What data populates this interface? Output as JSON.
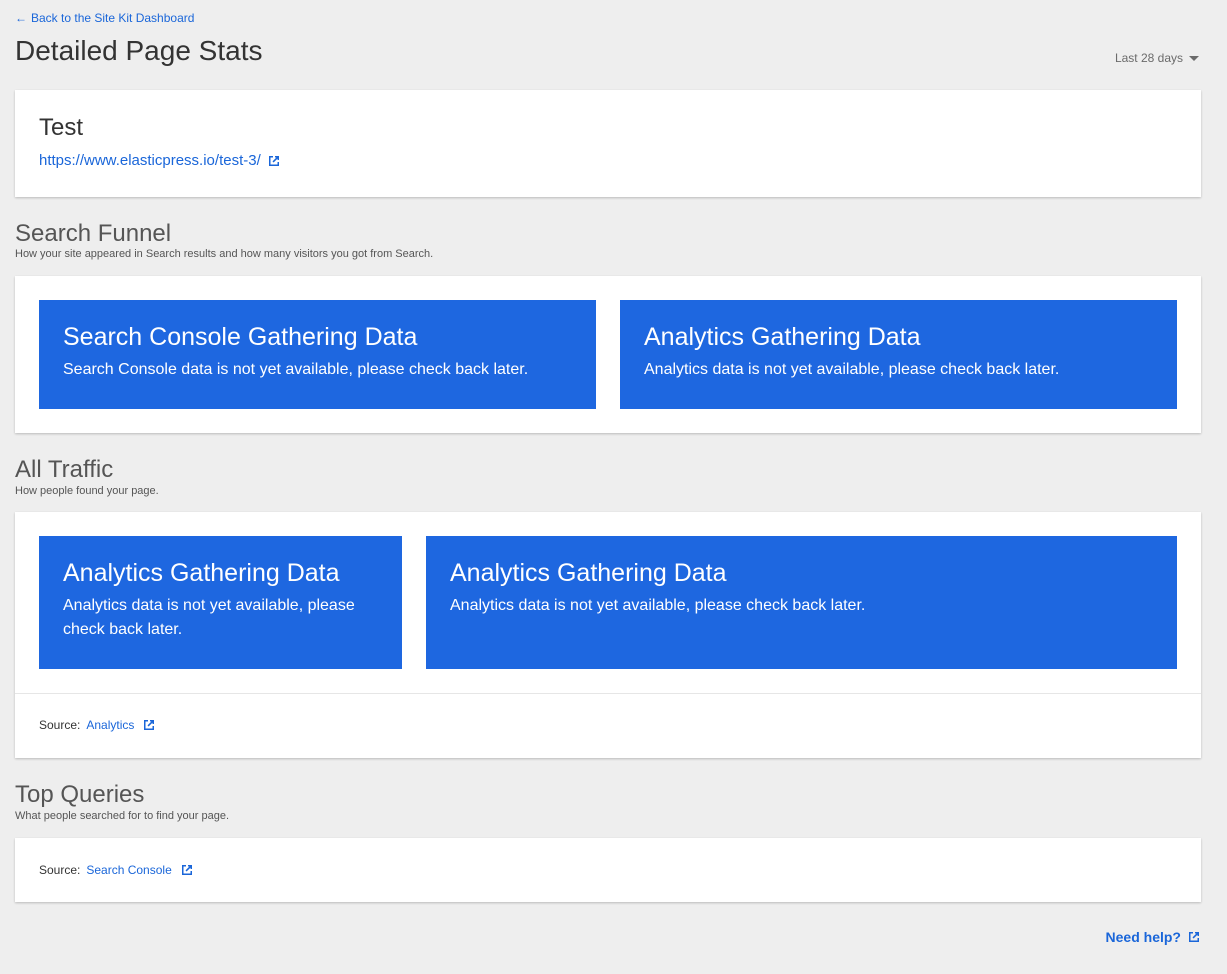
{
  "nav": {
    "back_label": "Back to the Site Kit Dashboard"
  },
  "header": {
    "title": "Detailed Page Stats",
    "date_range": "Last 28 days"
  },
  "page_card": {
    "title": "Test",
    "url": "https://www.elasticpress.io/test-3/"
  },
  "search_funnel": {
    "title": "Search Funnel",
    "description": "How your site appeared in Search results and how many visitors you got from Search.",
    "notices": [
      {
        "title": "Search Console Gathering Data",
        "text": "Search Console data is not yet available, please check back later."
      },
      {
        "title": "Analytics Gathering Data",
        "text": "Analytics data is not yet available, please check back later."
      }
    ]
  },
  "all_traffic": {
    "title": "All Traffic",
    "description": "How people found your page.",
    "notices": [
      {
        "title": "Analytics Gathering Data",
        "text": "Analytics data is not yet available, please check back later."
      },
      {
        "title": "Analytics Gathering Data",
        "text": "Analytics data is not yet available, please check back later."
      }
    ],
    "source_label": "Source:",
    "source_link": "Analytics"
  },
  "top_queries": {
    "title": "Top Queries",
    "description": "What people searched for to find your page.",
    "source_label": "Source:",
    "source_link": "Search Console"
  },
  "footer": {
    "help_label": "Need help?"
  },
  "colors": {
    "accent": "#1a66d9",
    "notice_bg": "#1e67e0",
    "page_bg": "#eeeeee"
  },
  "icons": [
    "arrow-left-icon",
    "chevron-down-icon",
    "external-link-icon"
  ]
}
